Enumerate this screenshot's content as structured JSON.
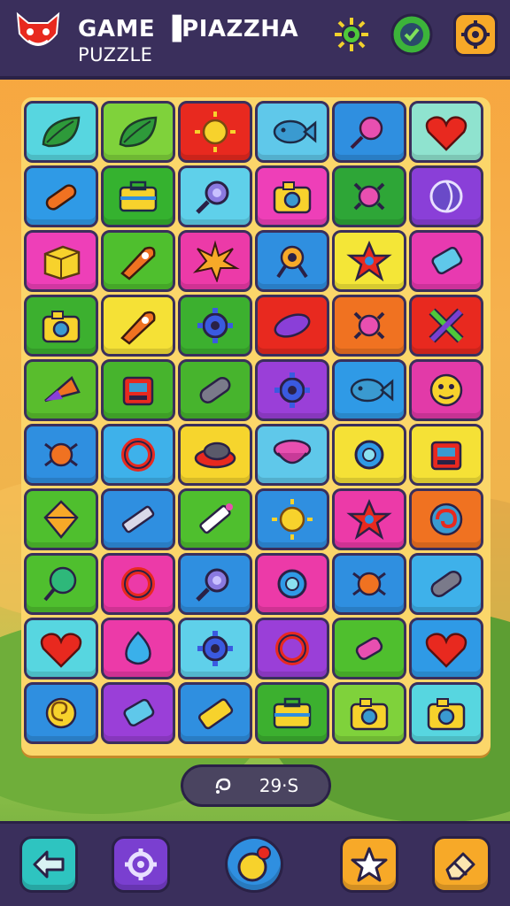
{
  "header": {
    "title": "GAME ▐PIAZZHA",
    "subtitle": "PUZZLE",
    "logo_icon": "red-cat-mascot-icon",
    "buttons": [
      {
        "icon": "sun-gear-icon"
      },
      {
        "icon": "check-badge-icon"
      },
      {
        "icon": "settings-gear-icon"
      }
    ]
  },
  "board": {
    "rows": 10,
    "cols": 6,
    "tiles": [
      [
        "leaf",
        "leaf",
        "sun",
        "fish",
        "planet",
        "heart"
      ],
      [
        "rolling-pin",
        "briefcase",
        "magnifier",
        "camera",
        "gear-bug",
        "ball"
      ],
      [
        "cube",
        "rocket",
        "spark",
        "target",
        "star",
        "bottle"
      ],
      [
        "camera",
        "rocket",
        "gear",
        "leaf-drop",
        "gear-bug",
        "cross"
      ],
      [
        "cone",
        "robot",
        "capsule",
        "gear",
        "fish",
        "smiley"
      ],
      [
        "bug",
        "ring",
        "hat",
        "bowl",
        "lens",
        "robot"
      ],
      [
        "kite",
        "pencil",
        "pen",
        "sun",
        "star",
        "swirl"
      ],
      [
        "balloon",
        "ring",
        "magnifier",
        "lens",
        "bug",
        "capsule"
      ],
      [
        "heart",
        "drop",
        "gear",
        "ring",
        "candy",
        "heart"
      ],
      [
        "snail",
        "bottle",
        "battery",
        "briefcase",
        "camera",
        "camera"
      ]
    ],
    "colors": [
      [
        "#57d6e0",
        "#7fd23b",
        "#e8291f",
        "#5fc8ea",
        "#2f8fe0",
        "#8fe3cf"
      ],
      [
        "#2f9ae6",
        "#35b22f",
        "#5fd0ea",
        "#ee3fb8",
        "#2ea637",
        "#8a3fd8"
      ],
      [
        "#ee3fb8",
        "#4fbf2e",
        "#ec3aa8",
        "#2f8fe0",
        "#f4e637",
        "#e83ab0"
      ],
      [
        "#3cb02f",
        "#f5e136",
        "#3cb02f",
        "#e8291f",
        "#f07221",
        "#e8291f"
      ],
      [
        "#59bd2d",
        "#47b42d",
        "#47b42d",
        "#9a3fd8",
        "#2f9ae6",
        "#e23aa8"
      ],
      [
        "#2f8fe0",
        "#3eb1ea",
        "#f6d52d",
        "#5fc8ea",
        "#f5e136",
        "#f5e136"
      ],
      [
        "#4fbf2e",
        "#2f8fe0",
        "#4fbf2e",
        "#2f8fe0",
        "#ec3aa8",
        "#f07221"
      ],
      [
        "#4fbf2e",
        "#ec3aa8",
        "#2f8fe0",
        "#ec3aa8",
        "#2f8fe0",
        "#3eb1ea"
      ],
      [
        "#57d6e0",
        "#ec3aa8",
        "#5fd0ea",
        "#9a3fd8",
        "#4fbf2e",
        "#2f9ae6"
      ],
      [
        "#2f8fe0",
        "#9a3fd8",
        "#2f8fe0",
        "#3cb02f",
        "#7fd23b",
        "#57d6e0"
      ]
    ]
  },
  "timer": {
    "icon": "swirl-timer-icon",
    "value": "29·S"
  },
  "footer": {
    "buttons": [
      {
        "icon": "back-arrow-icon",
        "color": "#2ec4c0"
      },
      {
        "icon": "settings-gear-icon",
        "color": "#7a3fd0"
      },
      {
        "icon": "bomb-ball-icon",
        "color": "#2f8fe0"
      },
      {
        "icon": "star-icon",
        "color": "#f7a928"
      },
      {
        "icon": "eraser-icon",
        "color": "#f7a928"
      }
    ]
  }
}
